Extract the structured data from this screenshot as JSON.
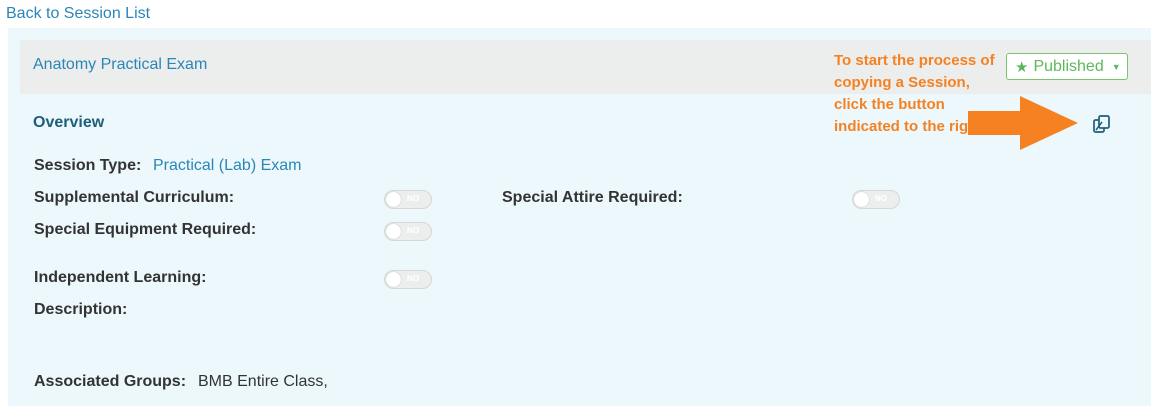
{
  "nav": {
    "back_label": "Back to Session List"
  },
  "session": {
    "title": "Anatomy Practical Exam",
    "status_label": "Published"
  },
  "overview": {
    "title": "Overview",
    "session_type_label": "Session Type:",
    "session_type_value": "Practical (Lab) Exam",
    "supplemental_label": "Supplemental Curriculum:",
    "special_attire_label": "Special Attire Required:",
    "special_equipment_label": "Special Equipment Required:",
    "independent_learning_label": "Independent Learning:",
    "description_label": "Description:",
    "associated_groups_label": "Associated Groups:",
    "associated_groups_value": "BMB Entire Class,",
    "toggle_text": "NO"
  },
  "annotation": {
    "text": "To start the process of copying a Session, click the button indicated to the right.",
    "color": "#f68121"
  },
  "icons": {
    "copy": "copy-icon",
    "star": "star-icon",
    "arrow": "arrow-right-icon"
  }
}
